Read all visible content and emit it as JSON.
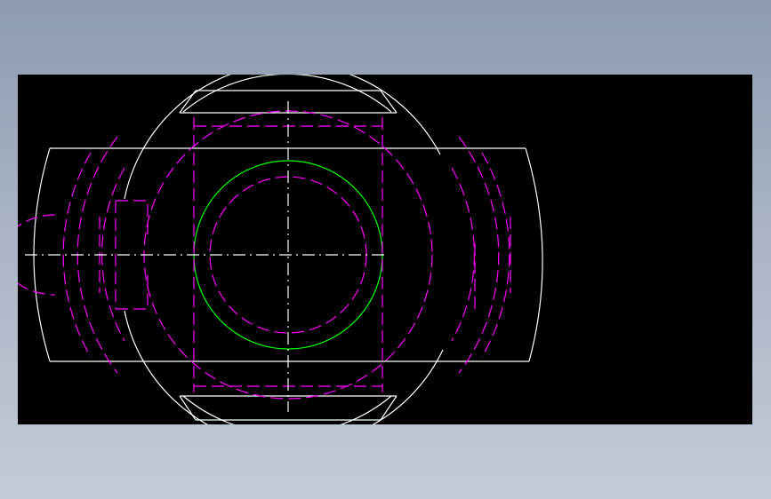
{
  "drawing": {
    "colors": {
      "background": "#000000",
      "outline": "#ffffff",
      "hidden": "#ff00ff",
      "highlight": "#00ff00",
      "centerline": "#ffffff"
    },
    "line_styles": {
      "outline": "continuous",
      "hidden": "dashed",
      "centerline": "dash-dot"
    }
  }
}
